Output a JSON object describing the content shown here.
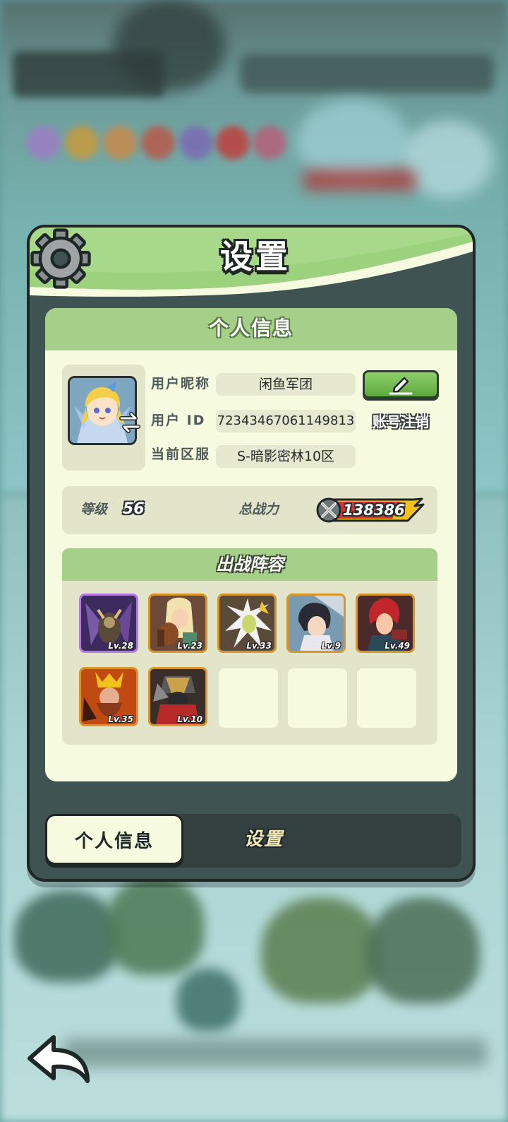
{
  "dialog": {
    "title": "设置"
  },
  "profile": {
    "section_title": "个人信息",
    "nickname_label": "用户昵称",
    "nickname": "闲鱼军团",
    "id_label": "用户 ID",
    "user_id": "72343467061149813",
    "account_cancel_label": "账号注销",
    "server_label": "当前区服",
    "server": "S-暗影密林10区"
  },
  "stats": {
    "level_label": "等级",
    "level": "56",
    "power_label": "总战力",
    "power": "138386"
  },
  "lineup": {
    "title": "出战阵容",
    "heroes": [
      {
        "level": "Lv.28",
        "rarity": "epic"
      },
      {
        "level": "Lv.23",
        "rarity": "legendary"
      },
      {
        "level": "Lv.33",
        "rarity": "legendary"
      },
      {
        "level": "Lv.9",
        "rarity": "legendary"
      },
      {
        "level": "Lv.49",
        "rarity": "legendary"
      },
      {
        "level": "Lv.35",
        "rarity": "legendary"
      },
      {
        "level": "Lv.10",
        "rarity": "legendary"
      }
    ],
    "empty_slots": 3
  },
  "tabs": [
    {
      "label": "个人信息",
      "active": true
    },
    {
      "label": "设置",
      "active": false
    }
  ],
  "icons": {
    "settings": "gear-icon",
    "edit": "pencil-icon",
    "swap": "swap-arrows-icon",
    "power": "crossed-swords-icon",
    "back": "back-arrow-icon"
  },
  "colors": {
    "accent_green": "#a6d08a",
    "button_green": "#5ba83d",
    "panel_bg": "#f6fbe0",
    "frame_dark": "#1e2626",
    "power_gold": "#f1c21b",
    "power_red": "#d8323a"
  }
}
